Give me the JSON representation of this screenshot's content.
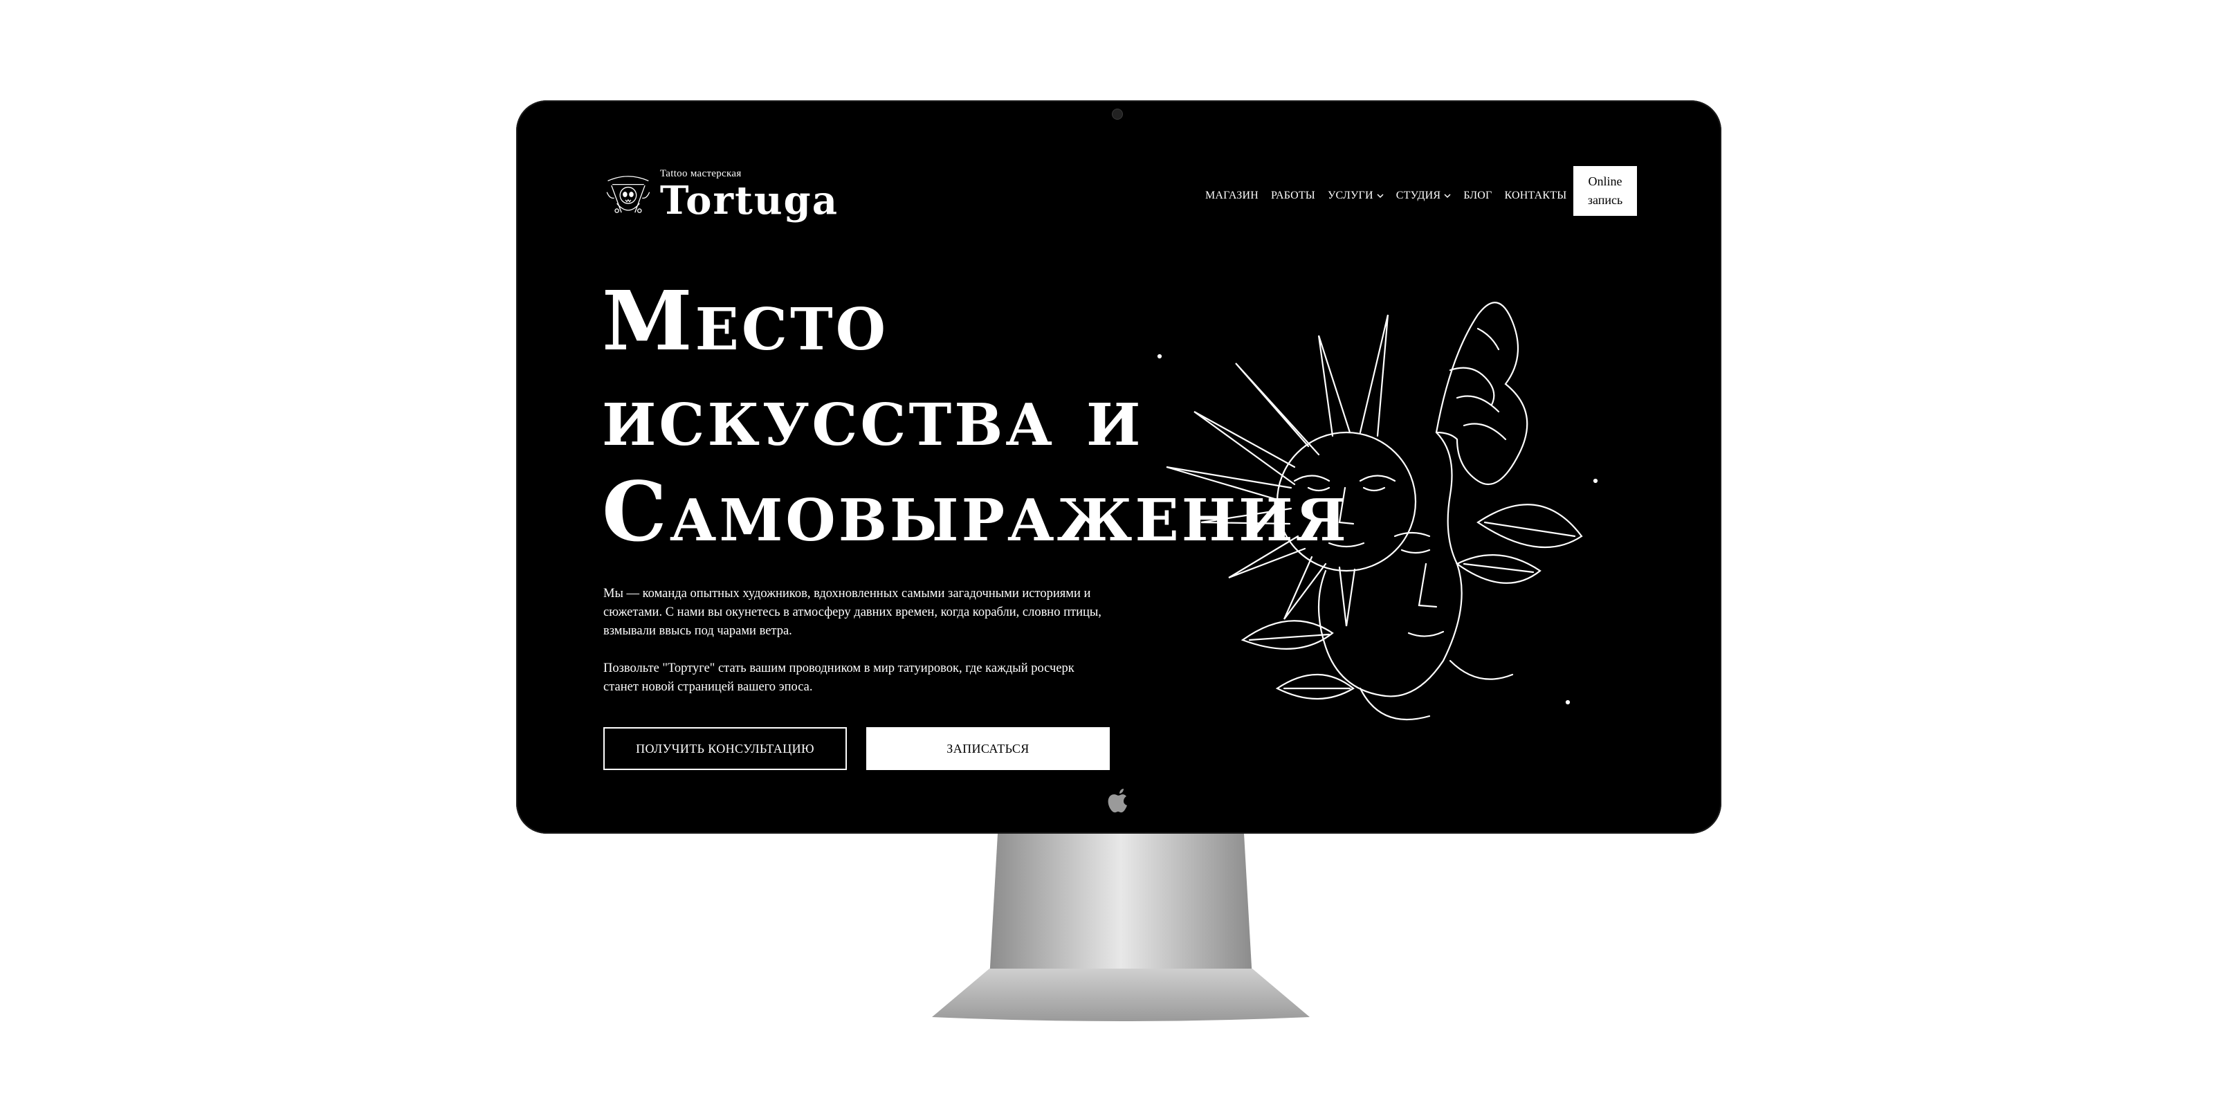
{
  "brand": {
    "subtitle": "Tattoo мастерская",
    "name": "Tortuga"
  },
  "nav": {
    "items": [
      {
        "label": "МАГАЗИН",
        "dropdown": false
      },
      {
        "label": "РАБОТЫ",
        "dropdown": false
      },
      {
        "label": "УСЛУГИ",
        "dropdown": true
      },
      {
        "label": "СТУДИЯ",
        "dropdown": true
      },
      {
        "label": "БЛОГ",
        "dropdown": false
      },
      {
        "label": "КОНТАКТЫ",
        "dropdown": false
      }
    ],
    "online_button": {
      "line1": "Online",
      "line2": "запись"
    }
  },
  "hero": {
    "title_lines": [
      "Место",
      "искусства и",
      "Самовыражения"
    ],
    "paragraphs": [
      "Мы — команда опытных художников, вдохновленных самыми загадочными историями и сюжетами. С нами вы окунетесь в атмосферу давних времен, когда корабли, словно птицы, взмывали ввысь под чарами ветра.",
      "Позвольте \"Тортуге\" стать вашим проводником в мир татуировок, где каждый росчерк станет новой страницей вашего эпоса."
    ],
    "consult_button": "ПОЛУЧИТЬ КОНСУЛЬТАЦИЮ",
    "signup_button": "ЗАПИСАТЬСЯ"
  },
  "colors": {
    "background": "#000000",
    "text": "#ffffff",
    "page": "#ffffff"
  },
  "icons": {
    "logo": "skull-anchor-emblem-icon",
    "dropdown": "chevron-down-icon",
    "device": "apple-logo-icon"
  }
}
